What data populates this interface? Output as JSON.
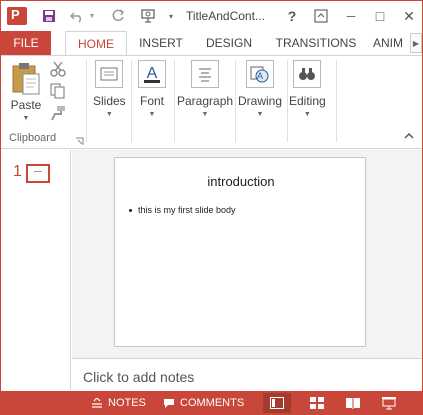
{
  "window": {
    "title": "TitleAndCont...",
    "help": "?",
    "restore_icon": "⊞",
    "minimize": "─",
    "maximize": "□",
    "close": "✕"
  },
  "ribbon_tabs": {
    "file": "FILE",
    "items": [
      "HOME",
      "INSERT",
      "DESIGN",
      "TRANSITIONS",
      "ANIM"
    ],
    "active": "HOME"
  },
  "ribbon": {
    "paste_label": "Paste",
    "clipboard_group": "Clipboard",
    "slides_label": "Slides",
    "font_label": "Font",
    "font_icon_letter": "A",
    "paragraph_label": "Paragraph",
    "drawing_label": "Drawing",
    "editing_label": "Editing"
  },
  "thumbnails": {
    "slide_number": "1"
  },
  "slide": {
    "title": "introduction",
    "body": "this is  my first slide body"
  },
  "notes": {
    "placeholder": "Click to add notes"
  },
  "statusbar": {
    "notes_label": "NOTES",
    "comments_label": "COMMENTS"
  },
  "colors": {
    "accent": "#c8463a",
    "accent_dark": "#a53b30"
  }
}
